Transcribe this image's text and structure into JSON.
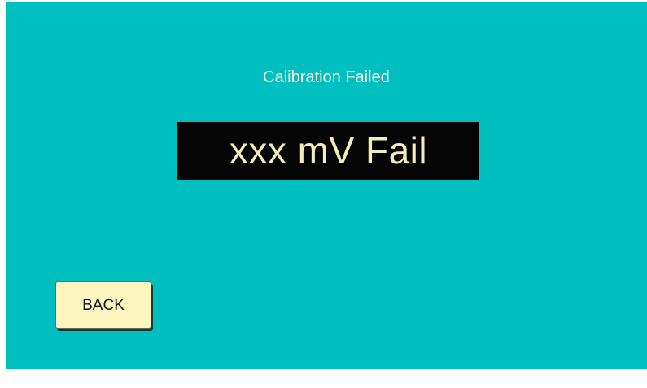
{
  "screen": {
    "title": "Calibration Failed",
    "readout": "xxx mV Fail",
    "back_label": "BACK"
  },
  "colors": {
    "background": "#00bfc0",
    "title_text": "#f4f4dc",
    "readout_background": "#050505",
    "readout_text": "#f3edb6",
    "button_background": "#fdf6c0"
  }
}
